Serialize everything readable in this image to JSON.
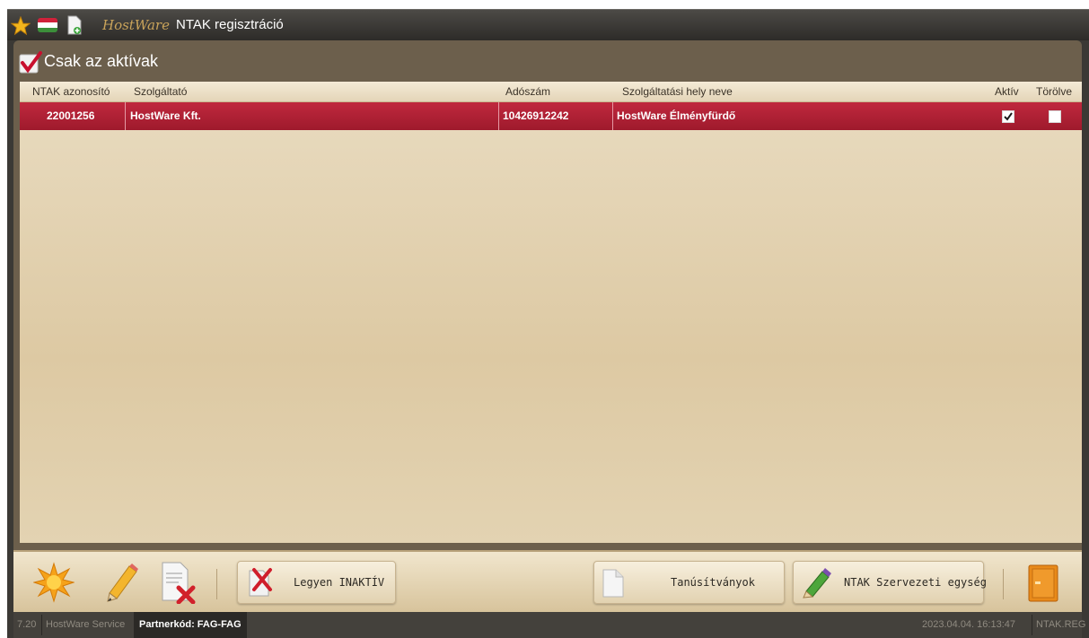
{
  "titlebar": {
    "brand": "HostWare",
    "title": "NTAK regisztráció",
    "icons": [
      "star-icon",
      "hungarian-flag-icon",
      "document-add-icon"
    ]
  },
  "filter": {
    "label": "Csak az aktívak",
    "checked": true
  },
  "table": {
    "columns": [
      "NTAK azonosító",
      "Szolgáltató",
      "Adószám",
      "Szolgáltatási hely neve",
      "Aktív",
      "Törölve"
    ],
    "rows": [
      {
        "ntak_id": "22001256",
        "provider": "HostWare Kft.",
        "tax_number": "10426912242",
        "place_name": "HostWare Élményfürdő",
        "active": true,
        "deleted": false
      }
    ]
  },
  "toolbar": {
    "icons": [
      "new-star-icon",
      "edit-pencil-icon",
      "delete-document-icon"
    ],
    "inactive_button": "Legyen INAKTÍV",
    "certificates_button": "Tanúsítványok",
    "org_unit_button": "NTAK Szervezeti egység",
    "exit_icon": "exit-door-icon"
  },
  "statusbar": {
    "version": "7.20",
    "service": "HostWare Service",
    "partner": "Partnerkód: FAG-FAG",
    "datetime": "2023.04.04. 16:13:47",
    "module": "NTAK.REG"
  },
  "colors": {
    "selected_row": "#b0223a",
    "panel": "#6c5f4c",
    "grid_background": "#e3d3b2",
    "accent_orange": "#e88a1a"
  }
}
